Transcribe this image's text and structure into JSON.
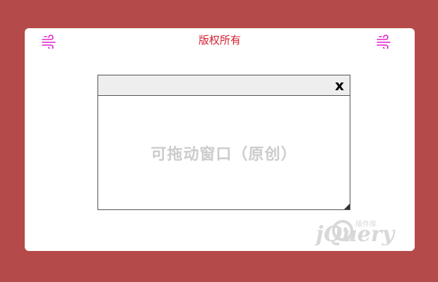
{
  "copyright": "版权所有",
  "dialog": {
    "close_label": "x",
    "body_text": "可拖动窗口（原创）"
  },
  "watermark": {
    "brand": "jQuery",
    "subtitle": "插件库"
  },
  "colors": {
    "background": "#b54a4a",
    "card": "#ffffff",
    "copyright_text": "#d4202f",
    "corner_icon": "#e020d0",
    "dialog_header": "#eeeeee",
    "dialog_body_text": "#cccccc"
  },
  "icons": {
    "left": "wind-icon",
    "right": "wind-icon"
  }
}
